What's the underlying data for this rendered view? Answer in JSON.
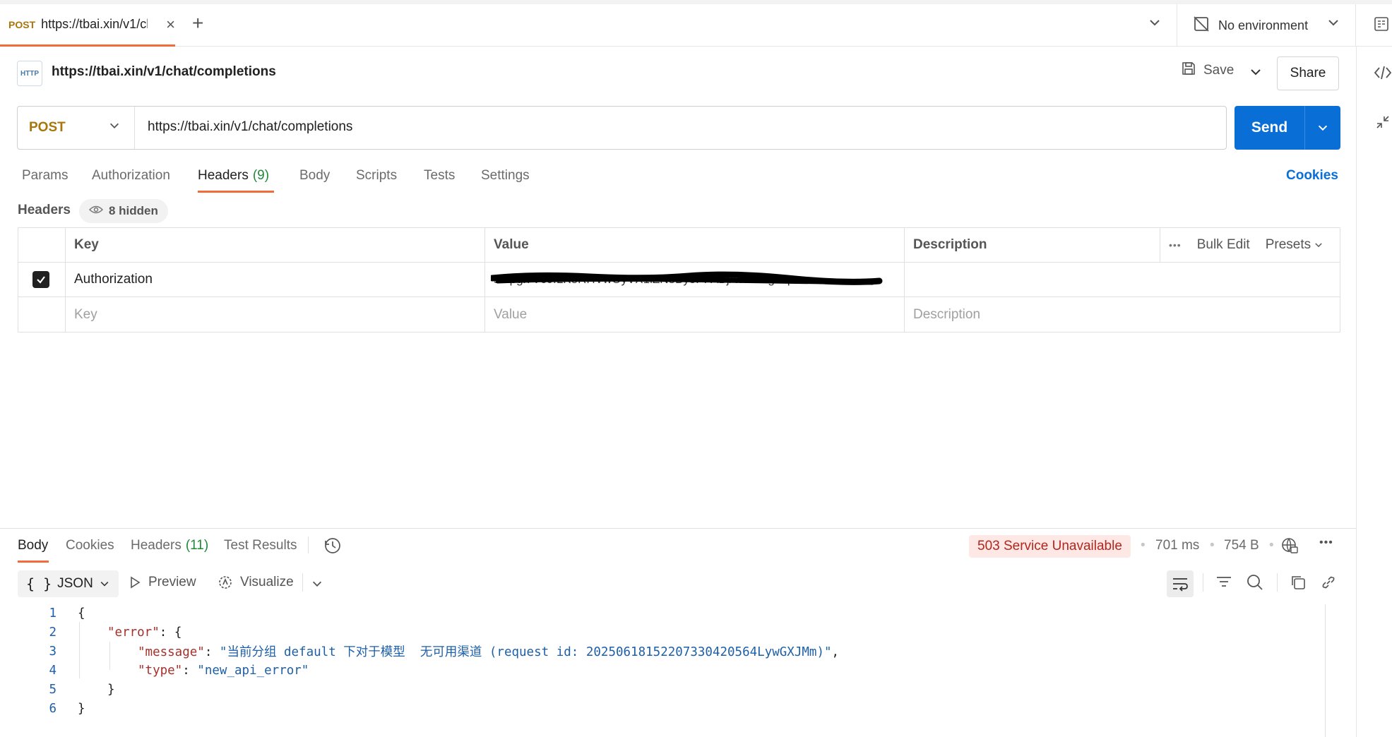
{
  "tab": {
    "method": "POST",
    "url": "https://tbai.xin/v1/ch",
    "close": "×",
    "new": "+"
  },
  "environment": {
    "label": "No environment"
  },
  "request": {
    "title": "https://tbai.xin/v1/chat/completions",
    "icon_text": "HTTP",
    "save_label": "Save",
    "share_label": "Share",
    "method": "POST",
    "url": "https://tbai.xin/v1/chat/completions",
    "send_label": "Send"
  },
  "request_tabs": {
    "params": "Params",
    "authorization": "Authorization",
    "headers": "Headers",
    "headers_count": "(9)",
    "body": "Body",
    "scripts": "Scripts",
    "tests": "Tests",
    "settings": "Settings",
    "cookies": "Cookies"
  },
  "headers": {
    "label": "Headers",
    "hidden": "8 hidden",
    "columns": {
      "key": "Key",
      "value": "Value",
      "description": "Description",
      "bulk_edit": "Bulk Edit",
      "presets": "Presets"
    },
    "rows": [
      {
        "checked": true,
        "key": "Authorization",
        "value": "sk-pgl7V0JfLKoRHVwOyVX1iZN8By5PFABjA6hr84gCq..."
      }
    ],
    "placeholder": {
      "key": "Key",
      "value": "Value",
      "description": "Description"
    }
  },
  "response": {
    "tabs": {
      "body": "Body",
      "cookies": "Cookies",
      "headers": "Headers",
      "headers_count": "(11)",
      "test_results": "Test Results"
    },
    "status": "503 Service Unavailable",
    "time": "701 ms",
    "size": "754 B",
    "format": "JSON",
    "preview": "Preview",
    "visualize": "Visualize",
    "lines": [
      {
        "n": "1"
      },
      {
        "n": "2"
      },
      {
        "n": "3"
      },
      {
        "n": "4"
      },
      {
        "n": "5"
      },
      {
        "n": "6"
      }
    ],
    "json": {
      "open": "{",
      "error_key": "\"error\"",
      "message_key": "\"message\"",
      "message_value": "\"当前分组 default 下对于模型  无可用渠道 (request id: 20250618152207330420564LywGXJMm)\"",
      "type_key": "\"type\"",
      "type_value": "\"new_api_error\"",
      "inner_close": "}",
      "close": "}"
    }
  },
  "colors": {
    "accent": "#f26b3a",
    "send": "#0a6ed7",
    "method": "#a8760a",
    "error_bg": "#fde8e6",
    "error_text": "#b3261e"
  }
}
